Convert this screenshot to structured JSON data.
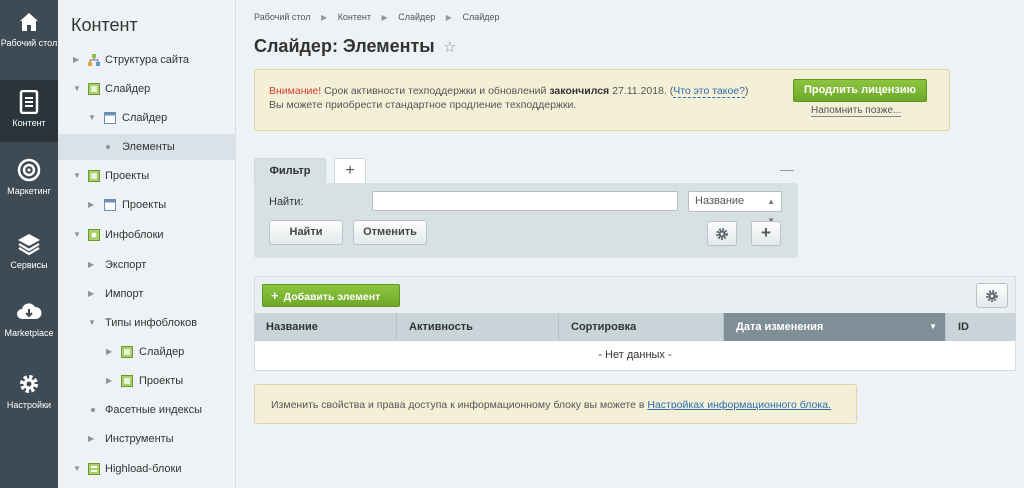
{
  "rail": {
    "items": [
      {
        "label": "Рабочий стол",
        "icon": "home-icon"
      },
      {
        "label": "Контент",
        "icon": "document-icon"
      },
      {
        "label": "Маркетинг",
        "icon": "target-icon"
      },
      {
        "label": "Сервисы",
        "icon": "layers-icon"
      },
      {
        "label": "Marketplace",
        "icon": "cloud-download-icon"
      },
      {
        "label": "Настройки",
        "icon": "gear-icon"
      }
    ]
  },
  "tree": {
    "title": "Контент",
    "items": [
      {
        "label": "Структура сайта"
      },
      {
        "label": "Слайдер"
      },
      {
        "label": "Слайдер"
      },
      {
        "label": "Элементы"
      },
      {
        "label": "Проекты"
      },
      {
        "label": "Проекты"
      },
      {
        "label": "Инфоблоки"
      },
      {
        "label": "Экспорт"
      },
      {
        "label": "Импорт"
      },
      {
        "label": "Типы инфоблоков"
      },
      {
        "label": "Слайдер"
      },
      {
        "label": "Проекты"
      },
      {
        "label": "Фасетные индексы"
      },
      {
        "label": "Инструменты"
      },
      {
        "label": "Highload-блоки"
      }
    ]
  },
  "breadcrumb": [
    "Рабочий стол",
    "Контент",
    "Слайдер",
    "Слайдер"
  ],
  "page_title": "Слайдер: Элементы",
  "notice": {
    "warning": "Внимание!",
    "text1": " Срок активности техподдержки и обновлений ",
    "expired": "закончился",
    "date": " 27.11.2018. (",
    "link": "Что это такое?",
    "close_paren": ")",
    "line2": "Вы можете приобрести стандартное продление техподдержки.",
    "renew_button": "Продлить лицензию",
    "remind_link": "Напомнить позже..."
  },
  "filter": {
    "tab_label": "Фильтр",
    "add_tab": "+",
    "minimize": "—",
    "find_label": "Найти:",
    "find_value": "",
    "field_select": "Название",
    "find_button": "Найти",
    "cancel_button": "Отменить",
    "add_button": "+"
  },
  "grid": {
    "add_button": "Добавить элемент",
    "columns": [
      "Название",
      "Активность",
      "Сортировка",
      "Дата изменения",
      "ID"
    ],
    "sorted_column": "Дата изменения",
    "empty_text": "- Нет данных -"
  },
  "info": {
    "text": "Изменить свойства и права доступа к информационному блоку вы можете в ",
    "link": "Настройках информационного блока."
  },
  "colors": {
    "rail_bg": "#3f4b54",
    "rail_active": "#2a343b",
    "accent_green": "#7ab635",
    "warning_red": "#d63b2f",
    "notice_bg": "#f4f0d8"
  }
}
